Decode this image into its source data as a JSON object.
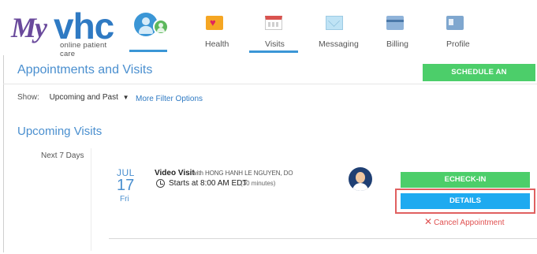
{
  "brand": {
    "logo_my": "My",
    "logo_vhc": "vhc",
    "tagline": "online patient care"
  },
  "nav": {
    "items": [
      {
        "label": "Health",
        "icon": "heart-icon"
      },
      {
        "label": "Visits",
        "icon": "calendar-icon"
      },
      {
        "label": "Messaging",
        "icon": "envelope-icon"
      },
      {
        "label": "Billing",
        "icon": "credit-card-icon"
      },
      {
        "label": "Profile",
        "icon": "id-card-icon"
      }
    ],
    "active": "Visits"
  },
  "page": {
    "title": "Appointments and Visits",
    "schedule_button": "SCHEDULE AN APPOINTMENT"
  },
  "filters": {
    "show_label": "Show:",
    "selected": "Upcoming and Past",
    "more": "More Filter Options"
  },
  "upcoming": {
    "title": "Upcoming Visits",
    "days_label": "Next 7 Days"
  },
  "visit": {
    "month": "JUL",
    "day": "17",
    "weekday": "Fri",
    "type": "Video Visit",
    "with_text": "with HONG HANH LE NGUYEN, DO",
    "start": "Starts at 8:00 AM EDT",
    "duration": "(30 minutes)",
    "echeck_button": "ECHECK-IN",
    "details_button": "DETAILS",
    "cancel_link": "Cancel Appointment"
  },
  "colors": {
    "accent_blue": "#4a8fcf",
    "green_button": "#4cce6a",
    "details_blue": "#1eaaf0",
    "cancel_red": "#e05050",
    "highlight_red": "#e06060"
  }
}
